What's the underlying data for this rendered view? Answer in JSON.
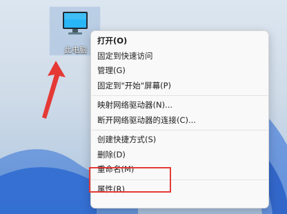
{
  "desktop": {
    "icon_label": "此电脑",
    "icon_name": "monitor-icon"
  },
  "annotation": {
    "arrow_color": "#e53935",
    "highlight_color": "#e53935"
  },
  "context_menu": {
    "groups": [
      [
        "打开(O)",
        "固定到快速访问",
        "管理(G)",
        "固定到\"开始\"屏幕(P)"
      ],
      [
        "映射网络驱动器(N)...",
        "断开网络驱动器的连接(C)..."
      ],
      [
        "创建快捷方式(S)",
        "删除(D)",
        "重命名(M)"
      ],
      [
        "属性(R)"
      ]
    ]
  }
}
